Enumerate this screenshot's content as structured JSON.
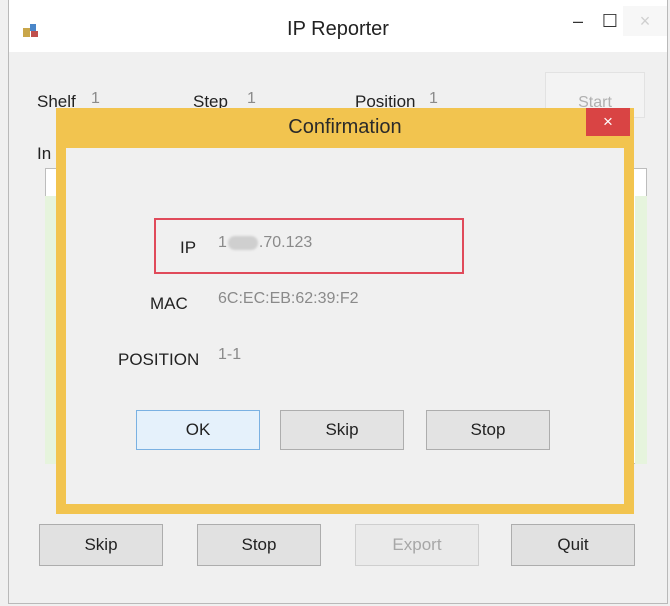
{
  "window": {
    "title": "IP Reporter",
    "controls": {
      "minimize": "–",
      "maximize": "☐",
      "close": "×"
    }
  },
  "fields": {
    "shelf": {
      "label": "Shelf",
      "value": "1"
    },
    "step": {
      "label": "Step",
      "value": "1"
    },
    "position": {
      "label": "Position",
      "value": "1"
    },
    "start_label": "Start",
    "partial_label": "In"
  },
  "buttons": {
    "skip": "Skip",
    "stop": "Stop",
    "export": "Export",
    "quit": "Quit"
  },
  "dialog": {
    "title": "Confirmation",
    "close": "×",
    "ip": {
      "label": "IP",
      "value_prefix": "1",
      "value_suffix": ".70.123"
    },
    "mac": {
      "label": "MAC",
      "value": "6C:EC:EB:62:39:F2"
    },
    "position": {
      "label": "POSITION",
      "value": "1-1"
    },
    "buttons": {
      "ok": "OK",
      "skip": "Skip",
      "stop": "Stop"
    }
  },
  "colors": {
    "dialog_frame": "#f2c44f",
    "highlight_box": "#e04a5a",
    "close_button": "#d94444"
  }
}
